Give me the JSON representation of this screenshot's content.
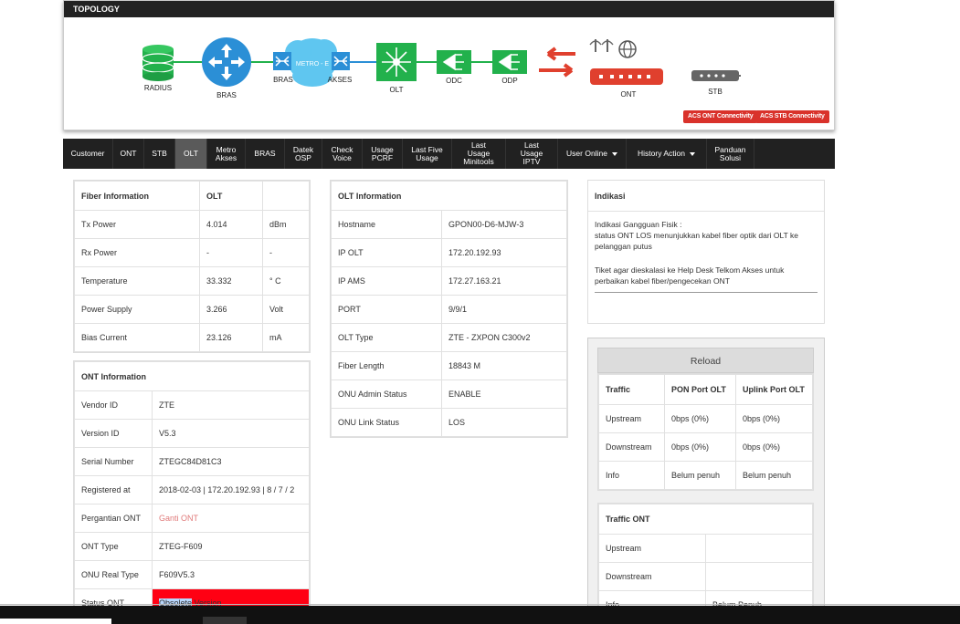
{
  "topology": {
    "title": "TOPOLOGY",
    "nodes": {
      "radius": "RADIUS",
      "bras": "BRAS",
      "bras2": "BRAS",
      "metro": "METRO - E",
      "akses": "AKSES",
      "olt": "OLT",
      "odc": "ODC",
      "odp": "ODP",
      "ont": "ONT",
      "stb": "STB"
    },
    "acs_ont": "ACS ONT Connectivity",
    "acs_stb": "ACS STB Connectivity",
    "colors": {
      "green": "#22b14c",
      "blue": "#2b8fd6",
      "red": "#e0402e",
      "gray": "#666666"
    }
  },
  "nav": {
    "items": [
      {
        "label": "Customer"
      },
      {
        "label": "ONT"
      },
      {
        "label": "STB"
      },
      {
        "label": "OLT"
      },
      {
        "label": "Metro\nAkses"
      },
      {
        "label": "BRAS"
      },
      {
        "label": "Datek\nOSP"
      },
      {
        "label": "Check\nVoice"
      },
      {
        "label": "Usage\nPCRF"
      },
      {
        "label": "Last Five\nUsage"
      },
      {
        "label": "Last Usage\nMinitools"
      },
      {
        "label": "Last Usage\nIPTV"
      },
      {
        "label": "User Online"
      },
      {
        "label": "History Action"
      },
      {
        "label": "Panduan\nSolusi"
      }
    ]
  },
  "fiber": {
    "header": [
      "Fiber Information",
      "OLT",
      ""
    ],
    "rows": [
      [
        "Tx Power",
        "4.014",
        "dBm"
      ],
      [
        "Rx Power",
        "-",
        "-"
      ],
      [
        "Temperature",
        "33.332",
        "° C"
      ],
      [
        "Power Supply",
        "3.266",
        "Volt"
      ],
      [
        "Bias Current",
        "23.126",
        "mA"
      ]
    ]
  },
  "ont": {
    "header": "ONT Information",
    "rows": [
      [
        "Vendor ID",
        "ZTE"
      ],
      [
        "Version ID",
        "V5.3"
      ],
      [
        "Serial Number",
        "ZTEGC84D81C3"
      ],
      [
        "Registered at",
        "2018-02-03 | 172.20.192.93 | 8 / 7 / 2"
      ],
      [
        "Pergantian ONT",
        "Ganti ONT"
      ],
      [
        "ONT Type",
        "ZTEG-F609"
      ],
      [
        "ONU Real Type",
        "F609V5.3"
      ]
    ],
    "status_label": "Status ONT",
    "status_sel": "Obsolete",
    "status_rest": " Version"
  },
  "olt": {
    "header": "OLT Information",
    "rows": [
      [
        "Hostname",
        "GPON00-D6-MJW-3"
      ],
      [
        "IP OLT",
        "172.20.192.93"
      ],
      [
        "IP AMS",
        "172.27.163.21"
      ],
      [
        "PORT",
        "9/9/1"
      ],
      [
        "OLT Type",
        "ZTE - ZXPON C300v2"
      ],
      [
        "Fiber Length",
        "18843 M"
      ],
      [
        "ONU Admin Status",
        "ENABLE"
      ],
      [
        "ONU Link Status",
        "LOS"
      ]
    ]
  },
  "indikasi": {
    "header": "Indikasi",
    "line1": "Indikasi Gangguan Fisik :",
    "line2": "status ONT LOS menunjukkan kabel fiber optik dari OLT ke pelanggan putus",
    "line3": "Tiket agar dieskalasi ke Help Desk Telkom Akses untuk perbaikan kabel fiber/pengecekan ONT"
  },
  "reload": {
    "label": "Reload"
  },
  "traffic": {
    "header": [
      "Traffic",
      "PON Port OLT",
      "Uplink Port OLT"
    ],
    "rows": [
      [
        "Upstream",
        "0bps (0%)",
        "0bps (0%)"
      ],
      [
        "Downstream",
        "0bps (0%)",
        "0bps (0%)"
      ],
      [
        "Info",
        "Belum penuh",
        "Belum penuh"
      ]
    ]
  },
  "traffic_ont": {
    "header": "Traffic ONT",
    "rows": [
      [
        "Upstream",
        ""
      ],
      [
        "Downstream",
        ""
      ],
      [
        "Info",
        "Belum Penuh"
      ]
    ]
  }
}
